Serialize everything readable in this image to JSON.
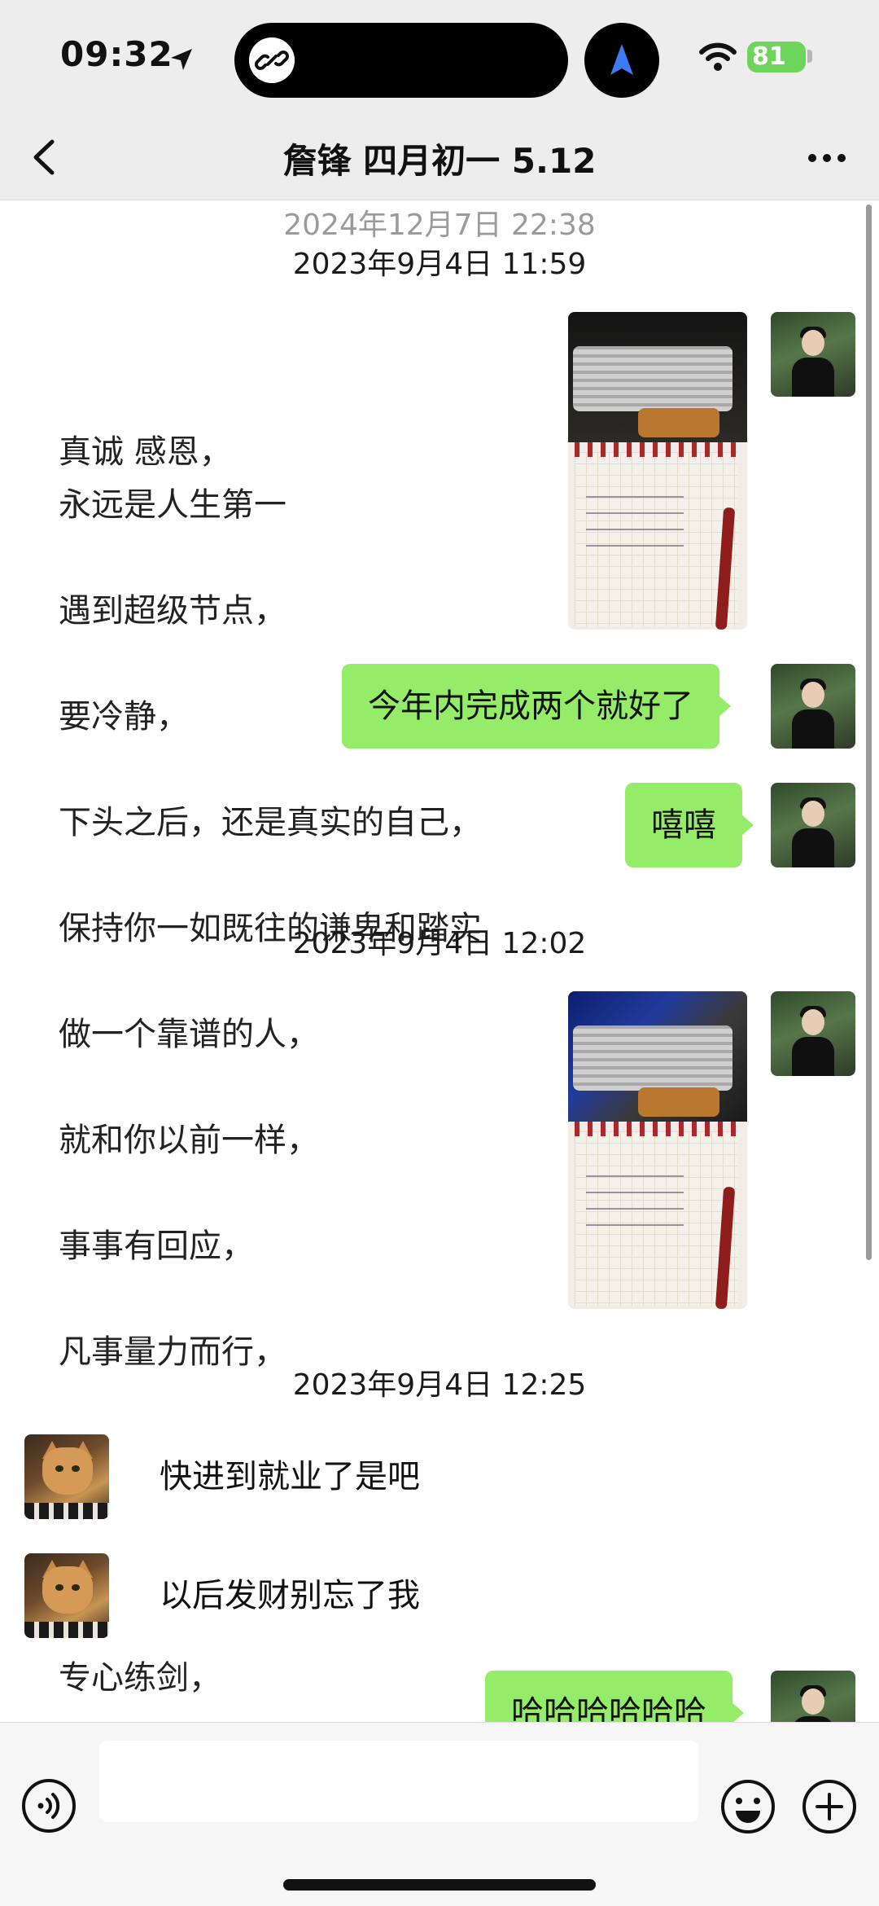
{
  "status_bar": {
    "time": "09:32",
    "battery": "81",
    "icons": [
      "location-arrow-icon",
      "link-icon",
      "navigation-icon",
      "wifi-icon",
      "battery-icon"
    ]
  },
  "nav": {
    "title": "詹锋 四月初一 5.12",
    "back_icon": "chevron-left-icon",
    "more_icon": "more-dots-icon"
  },
  "letter_lines": [
    "真诚 感恩，",
    "永远是人生第一",
    "遇到超级节点，",
    "要冷静，",
    "下头之后，还是真实的自己，",
    "保持你一如既往的谦卑和踏实",
    "做一个靠谱的人，",
    "就和你以前一样，",
    "事事有回应，",
    "凡事量力而行，",
    "专心练剑，"
  ],
  "messages": {
    "ts_old": "2024年12月7日 22:38",
    "ts1": "2023年9月4日 11:59",
    "m_goal": "今年内完成两个就好了",
    "m_xixi": "嘻嘻",
    "ts2": "2023年9月4日 12:02",
    "ts3": "2023年9月4日 12:25",
    "m_job": "快进到就业了是吧",
    "m_rich": "以后发财别忘了我",
    "m_haha": "哈哈哈哈哈哈"
  },
  "input": {
    "placeholder": "",
    "voice_icon": "voice-icon",
    "emoji_icon": "emoji-icon",
    "plus_icon": "plus-icon"
  },
  "colors": {
    "my_bubble": "#95ec69",
    "header_bg": "#ededed",
    "timestamp_old": "#9b9b9b"
  }
}
